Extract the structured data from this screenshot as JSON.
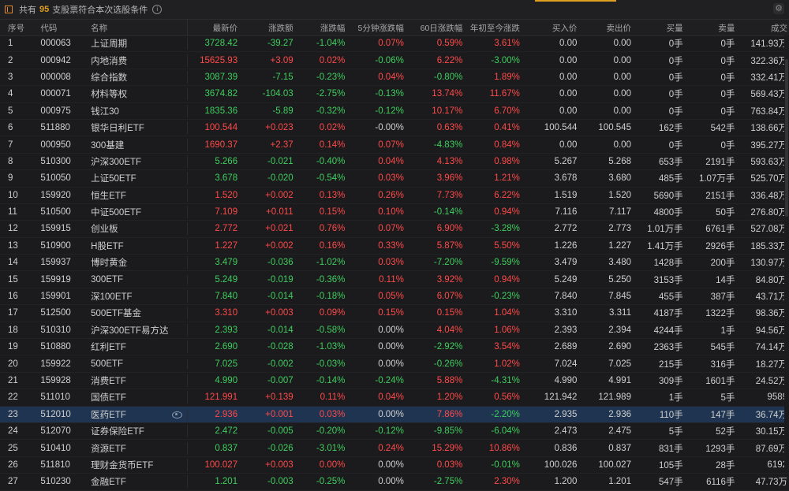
{
  "toolbar": {
    "prefix": "共有",
    "count": "95",
    "suffix": "支股票符合本次选股条件"
  },
  "columns": [
    "序号",
    "代码",
    "名称",
    "最新价",
    "涨跌额",
    "涨跌幅",
    "5分钟涨跌幅",
    "60日涨跌幅",
    "年初至今涨跌",
    "买入价",
    "卖出价",
    "买量",
    "卖量",
    "成交"
  ],
  "colors": {
    "up": "#ff4a4a",
    "down": "#3fce5e",
    "accent": "#e0a020",
    "selected": "#1e3450"
  },
  "rows": [
    {
      "idx": "1",
      "code": "000063",
      "name": "上证周期",
      "price": "3728.42",
      "chg": "-39.27",
      "pct": "-1.04%",
      "m5": "0.07%",
      "d60": "0.59%",
      "ytd": "3.61%",
      "bid": "0.00",
      "ask": "0.00",
      "bvol": "0手",
      "avol": "0手",
      "amt": "141.93万"
    },
    {
      "idx": "2",
      "code": "000942",
      "name": "内地消费",
      "price": "15625.93",
      "chg": "+3.09",
      "pct": "0.02%",
      "m5": "-0.06%",
      "d60": "6.22%",
      "ytd": "-3.00%",
      "bid": "0.00",
      "ask": "0.00",
      "bvol": "0手",
      "avol": "0手",
      "amt": "322.36万"
    },
    {
      "idx": "3",
      "code": "000008",
      "name": "综合指数",
      "price": "3087.39",
      "chg": "-7.15",
      "pct": "-0.23%",
      "m5": "0.04%",
      "d60": "-0.80%",
      "ytd": "1.89%",
      "bid": "0.00",
      "ask": "0.00",
      "bvol": "0手",
      "avol": "0手",
      "amt": "332.41万"
    },
    {
      "idx": "4",
      "code": "000071",
      "name": "材料等权",
      "price": "3674.82",
      "chg": "-104.03",
      "pct": "-2.75%",
      "m5": "-0.13%",
      "d60": "13.74%",
      "ytd": "11.67%",
      "bid": "0.00",
      "ask": "0.00",
      "bvol": "0手",
      "avol": "0手",
      "amt": "569.43万"
    },
    {
      "idx": "5",
      "code": "000975",
      "name": "钱江30",
      "price": "1835.36",
      "chg": "-5.89",
      "pct": "-0.32%",
      "m5": "-0.12%",
      "d60": "10.17%",
      "ytd": "6.70%",
      "bid": "0.00",
      "ask": "0.00",
      "bvol": "0手",
      "avol": "0手",
      "amt": "763.84万"
    },
    {
      "idx": "6",
      "code": "511880",
      "name": "银华日利ETF",
      "price": "100.544",
      "chg": "+0.023",
      "pct": "0.02%",
      "m5": "-0.00%",
      "d60": "0.63%",
      "ytd": "0.41%",
      "bid": "100.544",
      "ask": "100.545",
      "bvol": "162手",
      "avol": "542手",
      "amt": "138.66万"
    },
    {
      "idx": "7",
      "code": "000950",
      "name": "300基建",
      "price": "1690.37",
      "chg": "+2.37",
      "pct": "0.14%",
      "m5": "0.07%",
      "d60": "-4.83%",
      "ytd": "0.84%",
      "bid": "0.00",
      "ask": "0.00",
      "bvol": "0手",
      "avol": "0手",
      "amt": "395.27万"
    },
    {
      "idx": "8",
      "code": "510300",
      "name": "沪深300ETF",
      "price": "5.266",
      "chg": "-0.021",
      "pct": "-0.40%",
      "m5": "0.04%",
      "d60": "4.13%",
      "ytd": "0.98%",
      "bid": "5.267",
      "ask": "5.268",
      "bvol": "653手",
      "avol": "2191手",
      "amt": "593.63万"
    },
    {
      "idx": "9",
      "code": "510050",
      "name": "上证50ETF",
      "price": "3.678",
      "chg": "-0.020",
      "pct": "-0.54%",
      "m5": "0.03%",
      "d60": "3.96%",
      "ytd": "1.21%",
      "bid": "3.678",
      "ask": "3.680",
      "bvol": "485手",
      "avol": "1.07万手",
      "amt": "525.70万"
    },
    {
      "idx": "10",
      "code": "159920",
      "name": "恒生ETF",
      "price": "1.520",
      "chg": "+0.002",
      "pct": "0.13%",
      "m5": "0.26%",
      "d60": "7.73%",
      "ytd": "6.22%",
      "bid": "1.519",
      "ask": "1.520",
      "bvol": "5690手",
      "avol": "2151手",
      "amt": "336.48万"
    },
    {
      "idx": "11",
      "code": "510500",
      "name": "中证500ETF",
      "price": "7.109",
      "chg": "+0.011",
      "pct": "0.15%",
      "m5": "0.10%",
      "d60": "-0.14%",
      "ytd": "0.94%",
      "bid": "7.116",
      "ask": "7.117",
      "bvol": "4800手",
      "avol": "50手",
      "amt": "276.80万"
    },
    {
      "idx": "12",
      "code": "159915",
      "name": "创业板",
      "price": "2.772",
      "chg": "+0.021",
      "pct": "0.76%",
      "m5": "0.07%",
      "d60": "6.90%",
      "ytd": "-3.28%",
      "bid": "2.772",
      "ask": "2.773",
      "bvol": "1.01万手",
      "avol": "6761手",
      "amt": "527.08万"
    },
    {
      "idx": "13",
      "code": "510900",
      "name": "H股ETF",
      "price": "1.227",
      "chg": "+0.002",
      "pct": "0.16%",
      "m5": "0.33%",
      "d60": "5.87%",
      "ytd": "5.50%",
      "bid": "1.226",
      "ask": "1.227",
      "bvol": "1.41万手",
      "avol": "2926手",
      "amt": "185.33万"
    },
    {
      "idx": "14",
      "code": "159937",
      "name": "博时黄金",
      "price": "3.479",
      "chg": "-0.036",
      "pct": "-1.02%",
      "m5": "0.03%",
      "d60": "-7.20%",
      "ytd": "-9.59%",
      "bid": "3.479",
      "ask": "3.480",
      "bvol": "1428手",
      "avol": "200手",
      "amt": "130.97万"
    },
    {
      "idx": "15",
      "code": "159919",
      "name": "300ETF",
      "price": "5.249",
      "chg": "-0.019",
      "pct": "-0.36%",
      "m5": "0.11%",
      "d60": "3.92%",
      "ytd": "0.94%",
      "bid": "5.249",
      "ask": "5.250",
      "bvol": "3153手",
      "avol": "14手",
      "amt": "84.80万"
    },
    {
      "idx": "16",
      "code": "159901",
      "name": "深100ETF",
      "price": "7.840",
      "chg": "-0.014",
      "pct": "-0.18%",
      "m5": "0.05%",
      "d60": "6.07%",
      "ytd": "-0.23%",
      "bid": "7.840",
      "ask": "7.845",
      "bvol": "455手",
      "avol": "387手",
      "amt": "43.71万"
    },
    {
      "idx": "17",
      "code": "512500",
      "name": "500ETF基金",
      "price": "3.310",
      "chg": "+0.003",
      "pct": "0.09%",
      "m5": "0.15%",
      "d60": "0.15%",
      "ytd": "1.04%",
      "bid": "3.310",
      "ask": "3.311",
      "bvol": "4187手",
      "avol": "1322手",
      "amt": "98.36万"
    },
    {
      "idx": "18",
      "code": "510310",
      "name": "沪深300ETF易方达",
      "price": "2.393",
      "chg": "-0.014",
      "pct": "-0.58%",
      "m5": "0.00%",
      "d60": "4.04%",
      "ytd": "1.06%",
      "bid": "2.393",
      "ask": "2.394",
      "bvol": "4244手",
      "avol": "1手",
      "amt": "94.56万"
    },
    {
      "idx": "19",
      "code": "510880",
      "name": "红利ETF",
      "price": "2.690",
      "chg": "-0.028",
      "pct": "-1.03%",
      "m5": "0.00%",
      "d60": "-2.92%",
      "ytd": "3.54%",
      "bid": "2.689",
      "ask": "2.690",
      "bvol": "2363手",
      "avol": "545手",
      "amt": "74.14万"
    },
    {
      "idx": "20",
      "code": "159922",
      "name": "500ETF",
      "price": "7.025",
      "chg": "-0.002",
      "pct": "-0.03%",
      "m5": "0.00%",
      "d60": "-0.26%",
      "ytd": "1.02%",
      "bid": "7.024",
      "ask": "7.025",
      "bvol": "215手",
      "avol": "316手",
      "amt": "18.27万"
    },
    {
      "idx": "21",
      "code": "159928",
      "name": "消费ETF",
      "price": "4.990",
      "chg": "-0.007",
      "pct": "-0.14%",
      "m5": "-0.24%",
      "d60": "5.88%",
      "ytd": "-4.31%",
      "bid": "4.990",
      "ask": "4.991",
      "bvol": "309手",
      "avol": "1601手",
      "amt": "24.52万"
    },
    {
      "idx": "22",
      "code": "511010",
      "name": "国债ETF",
      "price": "121.991",
      "chg": "+0.139",
      "pct": "0.11%",
      "m5": "0.04%",
      "d60": "1.20%",
      "ytd": "0.56%",
      "bid": "121.942",
      "ask": "121.989",
      "bvol": "1手",
      "avol": "5手",
      "amt": "9589"
    },
    {
      "idx": "23",
      "code": "512010",
      "name": "医药ETF",
      "price": "2.936",
      "chg": "+0.001",
      "pct": "0.03%",
      "m5": "0.00%",
      "d60": "7.86%",
      "ytd": "-2.20%",
      "bid": "2.935",
      "ask": "2.936",
      "bvol": "110手",
      "avol": "147手",
      "amt": "36.74万",
      "selected": true
    },
    {
      "idx": "24",
      "code": "512070",
      "name": "证券保险ETF",
      "price": "2.472",
      "chg": "-0.005",
      "pct": "-0.20%",
      "m5": "-0.12%",
      "d60": "-9.85%",
      "ytd": "-6.04%",
      "bid": "2.473",
      "ask": "2.475",
      "bvol": "5手",
      "avol": "52手",
      "amt": "30.15万"
    },
    {
      "idx": "25",
      "code": "510410",
      "name": "资源ETF",
      "price": "0.837",
      "chg": "-0.026",
      "pct": "-3.01%",
      "m5": "0.24%",
      "d60": "15.29%",
      "ytd": "10.86%",
      "bid": "0.836",
      "ask": "0.837",
      "bvol": "831手",
      "avol": "1293手",
      "amt": "87.69万"
    },
    {
      "idx": "26",
      "code": "511810",
      "name": "理财金货币ETF",
      "price": "100.027",
      "chg": "+0.003",
      "pct": "0.00%",
      "m5": "0.00%",
      "d60": "0.03%",
      "ytd": "-0.01%",
      "bid": "100.026",
      "ask": "100.027",
      "bvol": "105手",
      "avol": "28手",
      "amt": "6192"
    },
    {
      "idx": "27",
      "code": "510230",
      "name": "金融ETF",
      "price": "1.201",
      "chg": "-0.003",
      "pct": "-0.25%",
      "m5": "0.00%",
      "d60": "-2.75%",
      "ytd": "2.30%",
      "bid": "1.200",
      "ask": "1.201",
      "bvol": "547手",
      "avol": "6116手",
      "amt": "47.73万"
    }
  ]
}
